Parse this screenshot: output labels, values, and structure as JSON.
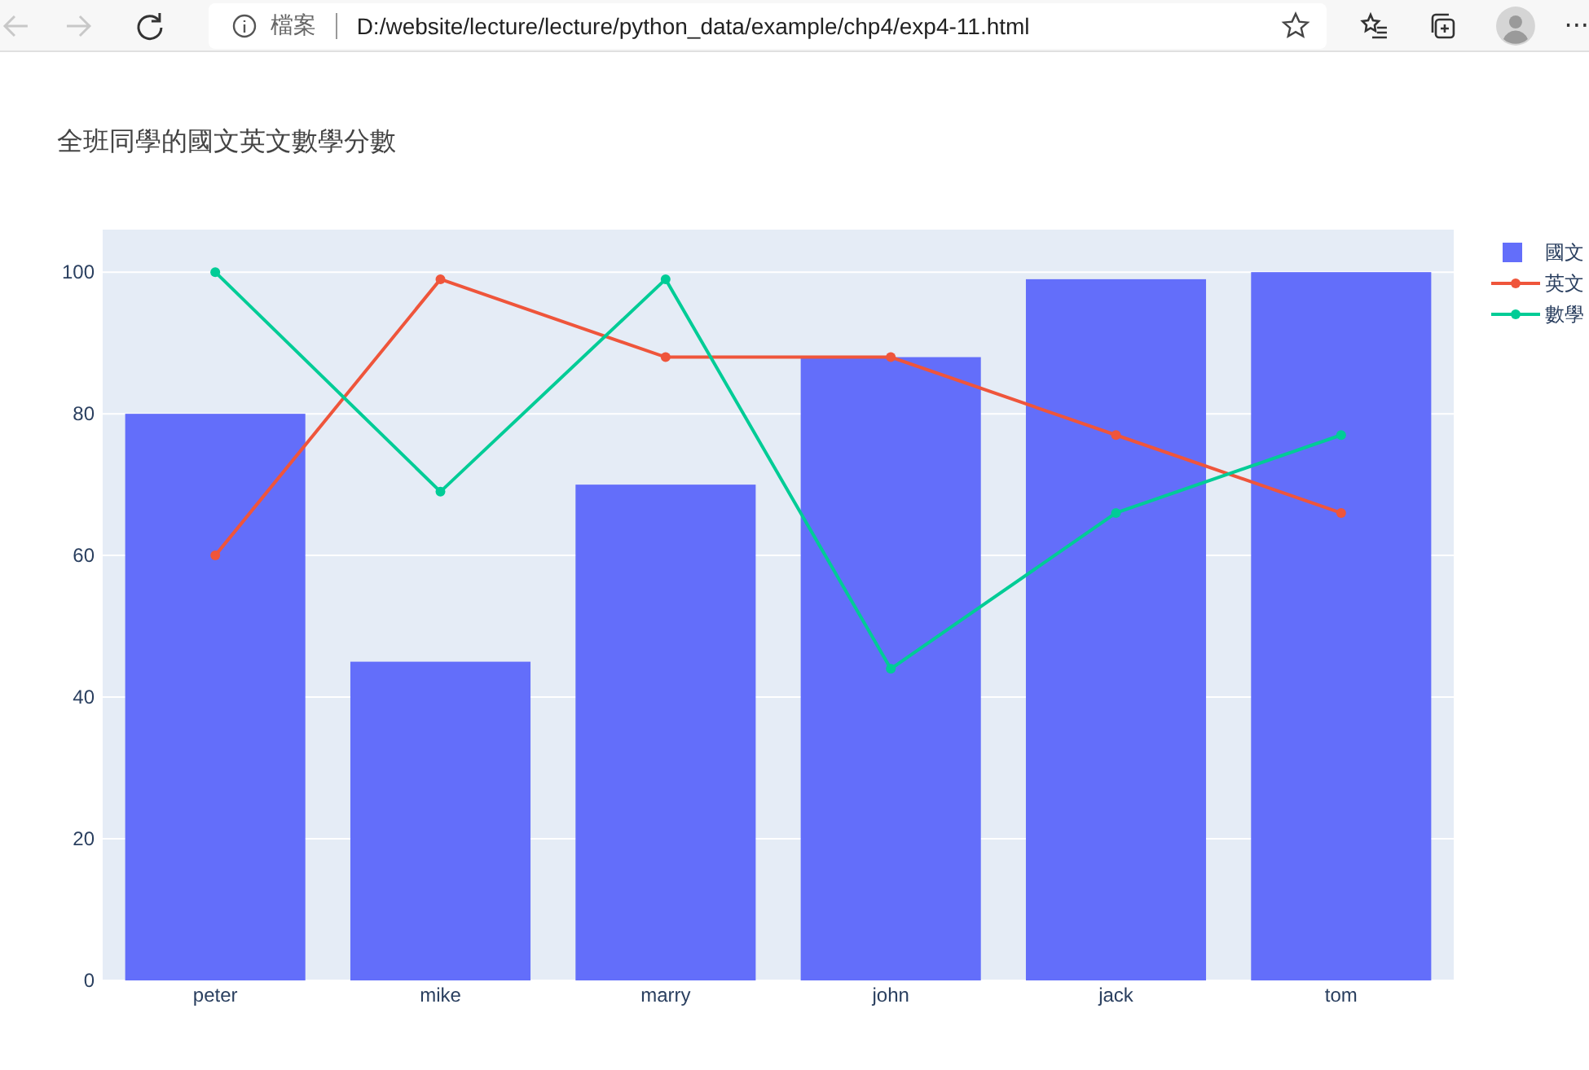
{
  "browser": {
    "back_disabled": true,
    "forward_disabled": true,
    "security_label": "檔案",
    "url": "D:/website/lecture/lecture/python_data/example/chp4/exp4-11.html",
    "menu_glyph": "···"
  },
  "chart": {
    "chart_data": {
      "type": "bar",
      "title": "全班同學的國文英文數學分數",
      "categories": [
        "peter",
        "mike",
        "marry",
        "john",
        "jack",
        "tom"
      ],
      "ylim": [
        0,
        106
      ],
      "grid": true,
      "legend": true,
      "yticks": [
        0,
        20,
        40,
        60,
        80,
        100
      ],
      "series": [
        {
          "name": "國文",
          "color": "#636efa",
          "values": [
            80,
            45,
            70,
            88,
            99,
            100
          ]
        },
        {
          "name": "英文",
          "type": "line",
          "marker": true,
          "color": "#ef553b",
          "values": [
            60,
            99,
            88,
            88,
            77,
            66
          ]
        },
        {
          "name": "數學",
          "type": "line",
          "marker": true,
          "color": "#00cc96",
          "values": [
            100,
            69,
            99,
            44,
            66,
            77
          ]
        }
      ]
    }
  }
}
